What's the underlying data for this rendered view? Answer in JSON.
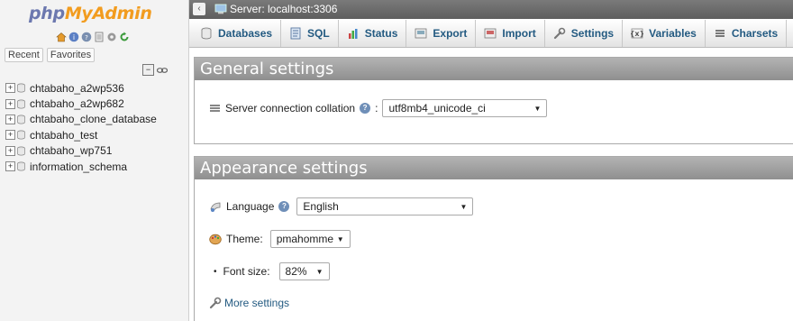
{
  "app": {
    "logo_php": "php",
    "logo_myadmin": "MyAdmin"
  },
  "nav": {
    "icons": [
      "home-icon",
      "info-icon",
      "sql-docs-icon",
      "settings-icon",
      "reload-icon"
    ],
    "tabs": [
      "Recent",
      "Favorites"
    ],
    "databases": [
      "chtabaho_a2wp536",
      "chtabaho_a2wp682",
      "chtabaho_clone_database",
      "chtabaho_test",
      "chtabaho_wp751",
      "information_schema"
    ]
  },
  "topbar": {
    "server": "Server: localhost:3306"
  },
  "menu": {
    "tabs": [
      {
        "label": "Databases",
        "icon": "database-icon"
      },
      {
        "label": "SQL",
        "icon": "sql-icon"
      },
      {
        "label": "Status",
        "icon": "status-icon"
      },
      {
        "label": "Export",
        "icon": "export-icon"
      },
      {
        "label": "Import",
        "icon": "import-icon"
      },
      {
        "label": "Settings",
        "icon": "wrench-icon"
      },
      {
        "label": "Variables",
        "icon": "variables-icon"
      },
      {
        "label": "Charsets",
        "icon": "charsets-icon"
      }
    ]
  },
  "general": {
    "title": "General settings",
    "collation_label": "Server connection collation",
    "collation_value": "utf8mb4_unicode_ci"
  },
  "appearance": {
    "title": "Appearance settings",
    "language_label": "Language",
    "language_value": "English",
    "theme_label": "Theme:",
    "theme_value": "pmahomme",
    "fontsize_label": "Font size:",
    "fontsize_value": "82%",
    "more_settings": "More settings"
  },
  "colors": {
    "link": "#235a81",
    "logo_blue": "#6c78af",
    "logo_orange": "#f29c1f"
  }
}
